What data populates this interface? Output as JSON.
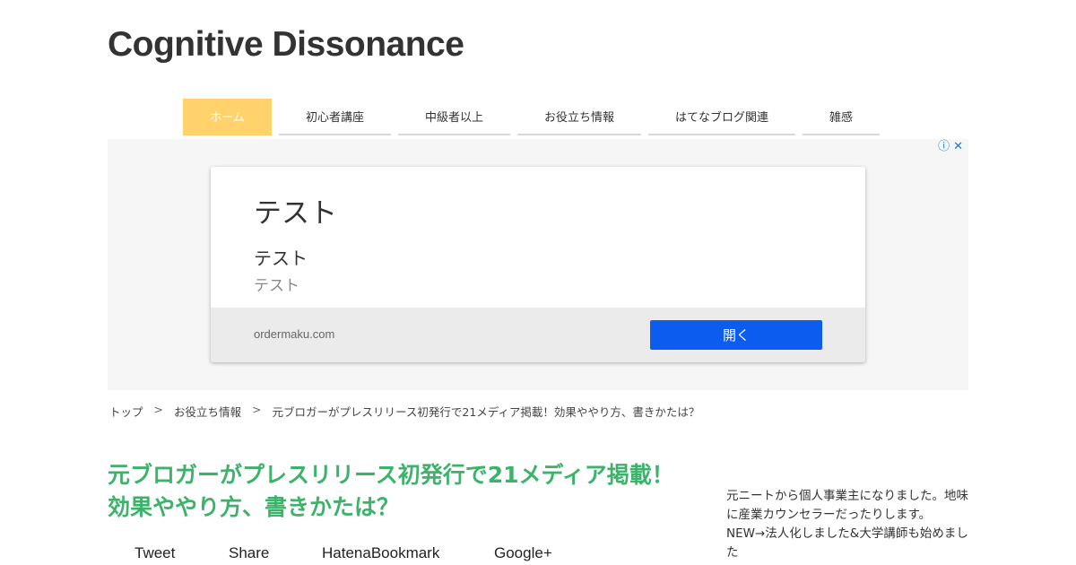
{
  "site": {
    "title": "Cognitive Dissonance"
  },
  "nav": {
    "items": [
      {
        "label": "ホーム",
        "active": true
      },
      {
        "label": "初心者講座"
      },
      {
        "label": "中級者以上"
      },
      {
        "label": "お役立ち情報"
      },
      {
        "label": "はてなブログ関連"
      },
      {
        "label": "雑感"
      }
    ]
  },
  "ad": {
    "headline": "テスト",
    "subheadline": "テスト",
    "description": "テスト",
    "domain": "ordermaku.com",
    "cta_label": "開く",
    "info_icon": "ⓘ",
    "close_icon": "✕"
  },
  "breadcrumb": {
    "items": [
      "トップ",
      "お役立ち情報",
      "元ブロガーがプレスリリース初発行で21メディア掲載！効果ややり方、書きかたは？"
    ],
    "separator": ">"
  },
  "post": {
    "title": "元ブロガーがプレスリリース初発行で21メディア掲載！効果ややり方、書きかたは？"
  },
  "share": {
    "tweet": "Tweet",
    "share": "Share",
    "hatena": "HatenaBookmark",
    "google": "Google+"
  },
  "sidebar": {
    "bio": "元ニートから個人事業主になりました。地味に産業カウンセラーだったりします。NEW→法人化しました&大学講師も始めました"
  },
  "colors": {
    "nav_active": "#ffd26b",
    "title_green": "#3db26b",
    "ad_button": "#0d5cf0"
  }
}
